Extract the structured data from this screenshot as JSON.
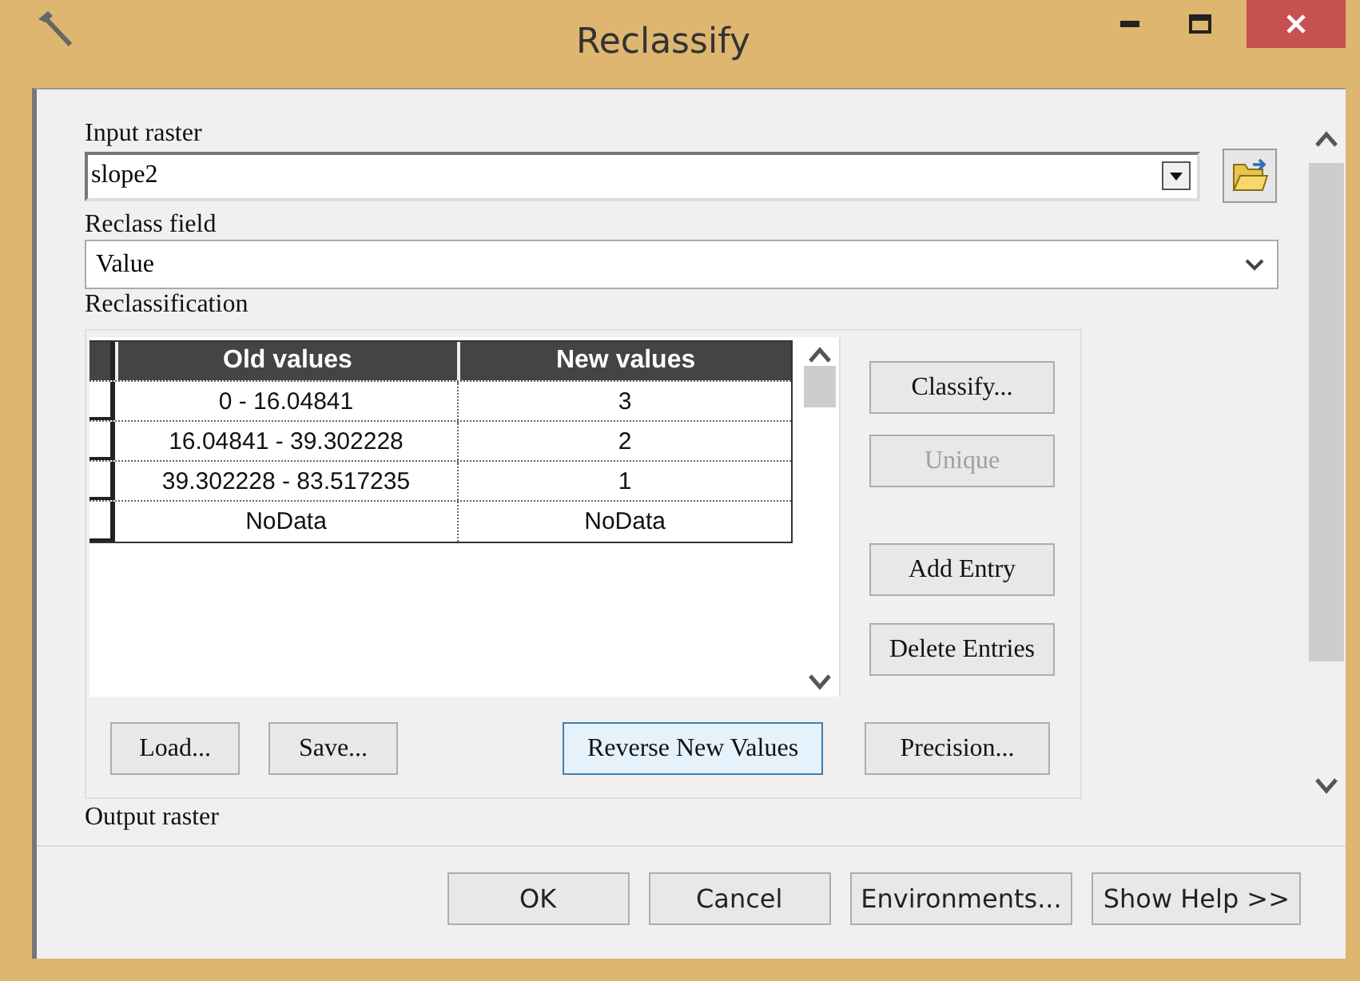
{
  "window": {
    "title": "Reclassify"
  },
  "input_raster": {
    "label": "Input raster",
    "value": "slope2"
  },
  "reclass_field": {
    "label": "Reclass field",
    "value": "Value"
  },
  "reclassification": {
    "label": "Reclassification",
    "table": {
      "columns": [
        "Old values",
        "New values"
      ],
      "rows": [
        {
          "old": "0 - 16.04841",
          "new": "3"
        },
        {
          "old": "16.04841 - 39.302228",
          "new": "2"
        },
        {
          "old": "39.302228 - 83.517235",
          "new": "1"
        },
        {
          "old": "NoData",
          "new": "NoData"
        }
      ]
    },
    "side_buttons": [
      {
        "label": "Classify...",
        "disabled": false
      },
      {
        "label": "Unique",
        "disabled": true
      },
      {
        "label": "Add Entry",
        "disabled": false
      },
      {
        "label": "Delete Entries",
        "disabled": false
      }
    ],
    "bottom_buttons": [
      {
        "label": "Load...",
        "focused": false
      },
      {
        "label": "Save...",
        "focused": false
      },
      {
        "label": "Reverse New Values",
        "focused": true
      },
      {
        "label": "Precision...",
        "focused": false
      }
    ]
  },
  "output_raster": {
    "label": "Output raster"
  },
  "dialog_buttons": [
    "OK",
    "Cancel",
    "Environments...",
    "Show Help >>"
  ]
}
